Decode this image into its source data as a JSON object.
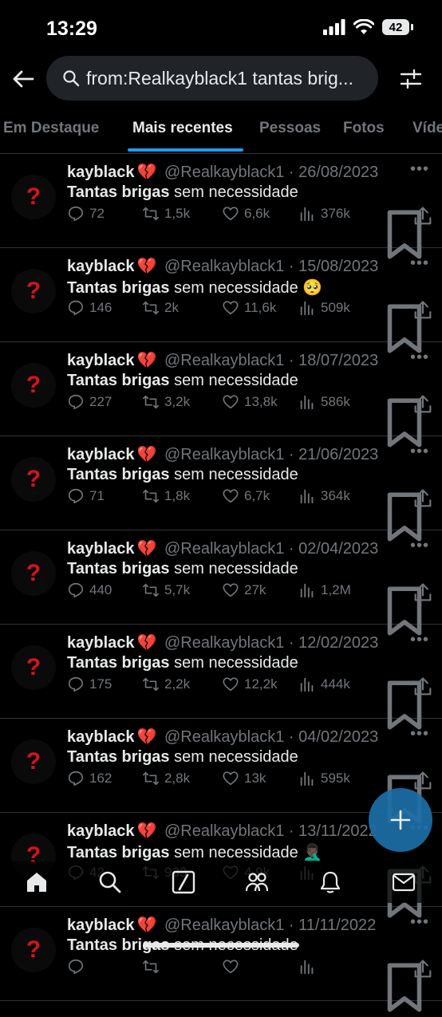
{
  "status": {
    "time": "13:29",
    "battery": "42"
  },
  "search": {
    "query": "from:Realkayblack1 tantas brig..."
  },
  "tabs": [
    "Em Destaque",
    "Mais recentes",
    "Pessoas",
    "Fotos",
    "Víde"
  ],
  "tweets": [
    {
      "name": "kayblack",
      "heart": "💔",
      "handle": "@Realkayblack1",
      "date": "26/08/2023",
      "bold": "Tantas brigas",
      "rest": " sem necessidade",
      "emoji": "",
      "replies": "72",
      "retweets": "1,5k",
      "likes": "6,6k",
      "views": "376k"
    },
    {
      "name": "kayblack",
      "heart": "💔",
      "handle": "@Realkayblack1",
      "date": "15/08/2023",
      "bold": "Tantas brigas",
      "rest": " sem necessidade ",
      "emoji": "🥺",
      "replies": "146",
      "retweets": "2k",
      "likes": "11,6k",
      "views": "509k"
    },
    {
      "name": "kayblack",
      "heart": "💔",
      "handle": "@Realkayblack1",
      "date": "18/07/2023",
      "bold": "Tantas brigas",
      "rest": " sem necessidade",
      "emoji": "",
      "replies": "227",
      "retweets": "3,2k",
      "likes": "13,8k",
      "views": "586k"
    },
    {
      "name": "kayblack",
      "heart": "💔",
      "handle": "@Realkayblack1",
      "date": "21/06/2023",
      "bold": "Tantas brigas",
      "rest": " sem necessidade",
      "emoji": "",
      "replies": "71",
      "retweets": "1,8k",
      "likes": "6,7k",
      "views": "364k"
    },
    {
      "name": "kayblack",
      "heart": "💔",
      "handle": "@Realkayblack1",
      "date": "02/04/2023",
      "bold": "Tantas brigas",
      "rest": " sem necessidade",
      "emoji": "",
      "replies": "440",
      "retweets": "5,7k",
      "likes": "27k",
      "views": "1,2M"
    },
    {
      "name": "kayblack",
      "heart": "💔",
      "handle": "@Realkayblack1",
      "date": "12/02/2023",
      "bold": "Tantas brigas",
      "rest": " sem necessidade",
      "emoji": "",
      "replies": "175",
      "retweets": "2,2k",
      "likes": "12,2k",
      "views": "444k"
    },
    {
      "name": "kayblack",
      "heart": "💔",
      "handle": "@Realkayblack1",
      "date": "04/02/2023",
      "bold": "Tantas brigas",
      "rest": " sem necessidade",
      "emoji": "",
      "replies": "162",
      "retweets": "2,8k",
      "likes": "13k",
      "views": "595k"
    },
    {
      "name": "kayblack",
      "heart": "💔",
      "handle": "@Realkayblack1",
      "date": "13/11/2022",
      "bold": "Tantas brigas",
      "rest": " sem necessidade ",
      "emoji": "🤦🏿‍♂️",
      "replies": "42",
      "retweets": "933",
      "likes": "4,9k",
      "views": ""
    },
    {
      "name": "kayblack",
      "heart": "💔",
      "handle": "@Realkayblack1",
      "date": "11/11/2022",
      "bold": "Tantas brigas",
      "rest": " sem necessidade",
      "emoji": "",
      "replies": "",
      "retweets": "",
      "likes": "",
      "views": ""
    }
  ],
  "icons": {
    "avatar": "question-mark-icon",
    "nav": [
      "home-icon",
      "search-icon",
      "grok-icon",
      "communities-icon",
      "notifications-icon",
      "messages-icon"
    ],
    "fab": "compose-icon"
  },
  "colors": {
    "accent": "#1d9bf0",
    "avatar_mark": "#d4141b",
    "muted": "#71767b"
  }
}
